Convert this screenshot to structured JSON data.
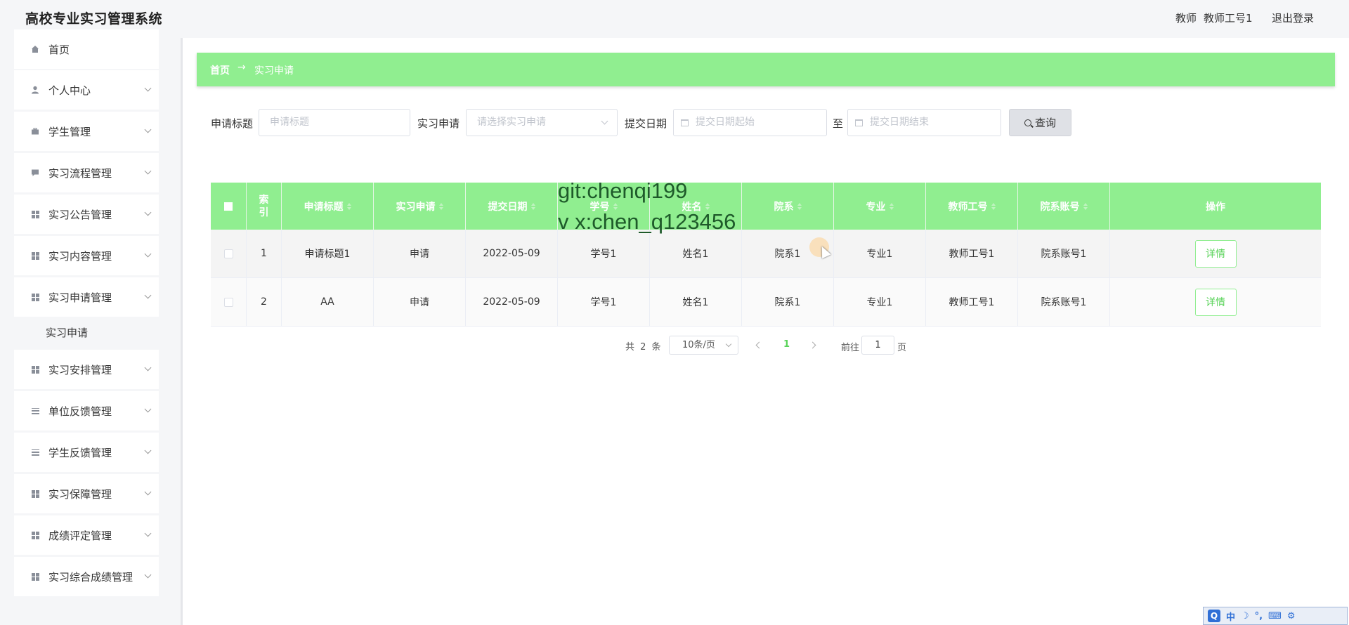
{
  "header": {
    "app_title": "高校专业实习管理系统",
    "user_role": "教师",
    "user_name": "教师工号1",
    "logout_label": "退出登录"
  },
  "sidebar": {
    "items": [
      {
        "label": "首页",
        "icon": "home-icon"
      },
      {
        "label": "个人中心",
        "icon": "user-icon"
      },
      {
        "label": "学生管理",
        "icon": "briefcase-icon"
      },
      {
        "label": "实习流程管理",
        "icon": "chat-icon"
      },
      {
        "label": "实习公告管理",
        "icon": "grid-icon"
      },
      {
        "label": "实习内容管理",
        "icon": "grid-icon"
      },
      {
        "label": "实习申请管理",
        "icon": "grid-icon"
      },
      {
        "label": "实习安排管理",
        "icon": "grid-icon"
      },
      {
        "label": "单位反馈管理",
        "icon": "list-icon"
      },
      {
        "label": "学生反馈管理",
        "icon": "list-icon"
      },
      {
        "label": "实习保障管理",
        "icon": "grid-icon"
      },
      {
        "label": "成绩评定管理",
        "icon": "grid-icon"
      },
      {
        "label": "实习综合成绩管理",
        "icon": "grid-icon"
      }
    ],
    "submenu": {
      "label": "实习申请"
    }
  },
  "breadcrumb": {
    "home": "首页",
    "separator": "→",
    "current": "实习申请"
  },
  "search": {
    "title_label": "申请标题",
    "title_placeholder": "申请标题",
    "apply_label": "实习申请",
    "apply_placeholder": "请选择实习申请",
    "date_label": "提交日期",
    "date_start_placeholder": "提交日期起始",
    "date_sep": "至",
    "date_end_placeholder": "提交日期结束",
    "query_label": "查询"
  },
  "table": {
    "columns": [
      "索引",
      "申请标题",
      "实习申请",
      "提交日期",
      "学号",
      "姓名",
      "院系",
      "专业",
      "教师工号",
      "院系账号",
      "操作"
    ],
    "rows": [
      {
        "index": "1",
        "title": "申请标题1",
        "apply": "申请",
        "date": "2022-05-09",
        "student_no": "学号1",
        "name": "姓名1",
        "dept": "院系1",
        "major": "专业1",
        "teacher_no": "教师工号1",
        "dept_account": "院系账号1",
        "action": "详情"
      },
      {
        "index": "2",
        "title": "AA",
        "apply": "申请",
        "date": "2022-05-09",
        "student_no": "学号1",
        "name": "姓名1",
        "dept": "院系1",
        "major": "专业1",
        "teacher_no": "教师工号1",
        "dept_account": "院系账号1",
        "action": "详情"
      }
    ]
  },
  "pagination": {
    "total": "共 2 条",
    "page_size": "10条/页",
    "current_page": "1",
    "goto_label": "前往",
    "goto_value": "1",
    "goto_unit": "页"
  },
  "watermark": {
    "line1": "git:chenqi199",
    "line2": "v x:chen_q123456"
  },
  "ime": {
    "logo": "Q",
    "mode": "中"
  },
  "colors": {
    "accent_green": "#90ee90",
    "link_green": "#5ad35a",
    "sidebar_bg": "#f5f6f8"
  }
}
